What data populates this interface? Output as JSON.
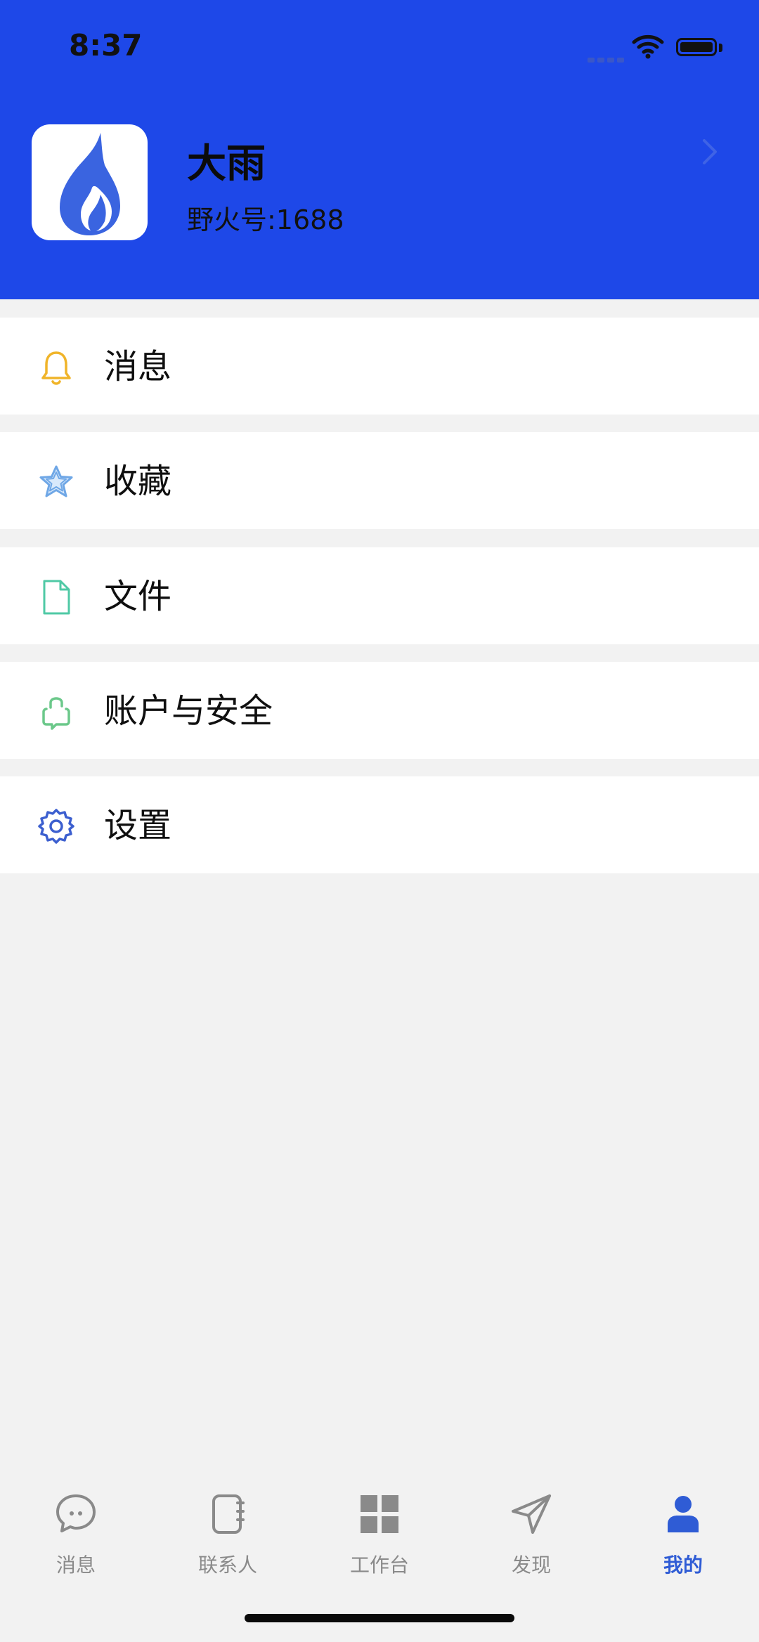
{
  "status_bar": {
    "time": "8:37"
  },
  "profile": {
    "name": "大雨",
    "id_label": "野火号:1688"
  },
  "menu": [
    {
      "label": "消息",
      "icon": "bell-icon",
      "color": "#f0b429"
    },
    {
      "label": "收藏",
      "icon": "star-icon",
      "color": "#6fa7e6"
    },
    {
      "label": "文件",
      "icon": "file-icon",
      "color": "#4fc9a5"
    },
    {
      "label": "账户与安全",
      "icon": "lock-icon",
      "color": "#6bc88a"
    },
    {
      "label": "设置",
      "icon": "gear-icon",
      "color": "#3c5fcf"
    }
  ],
  "tabbar": {
    "items": [
      {
        "label": "消息",
        "icon": "chat-icon"
      },
      {
        "label": "联系人",
        "icon": "contacts-icon"
      },
      {
        "label": "工作台",
        "icon": "workbench-icon"
      },
      {
        "label": "发现",
        "icon": "discover-icon"
      },
      {
        "label": "我的",
        "icon": "profile-icon",
        "active": true
      }
    ]
  },
  "colors": {
    "header": "#1e48e8",
    "accent": "#2f5cd5",
    "background": "#f2f2f2"
  }
}
